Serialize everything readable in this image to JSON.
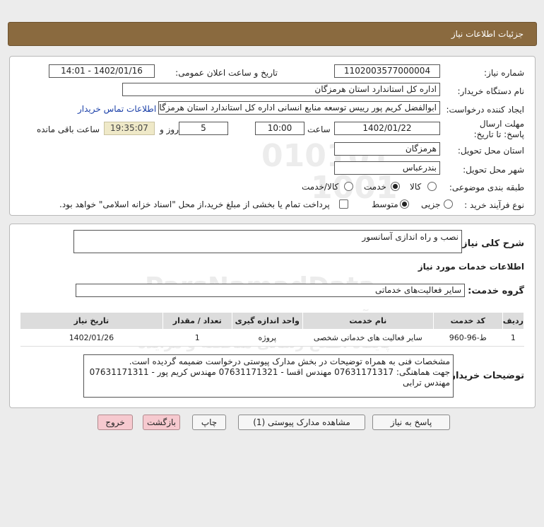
{
  "header": {
    "title": "جزئیات اطلاعات نیاز"
  },
  "form": {
    "need_number_label": "شماره نیاز:",
    "need_number": "1102003577000004",
    "announce_label": "تاریخ و ساعت اعلان عمومی:",
    "announce_value": "1402/01/16 - 14:01",
    "buyer_label": "نام دستگاه خریدار:",
    "buyer_value": "اداره کل استاندارد استان هرمزگان",
    "creator_label": "ایجاد کننده درخواست:",
    "creator_value": "ابوالفضل کریم پور رییس توسعه منابع انسانی اداره کل استاندارد استان هرمزگان",
    "contact_link": "اطلاعات تماس خریدار",
    "deadline_label": "مهلت ارسال پاسخ: تا تاریخ:",
    "deadline_date": "1402/01/22",
    "time_label": "ساعت",
    "deadline_time": "10:00",
    "days_value": "5",
    "days_label": "روز و",
    "remaining_time": "19:35:07",
    "remaining_label": "ساعت باقی مانده",
    "province_label": "استان محل تحویل:",
    "province_value": "هرمزگان",
    "city_label": "شهر محل تحویل:",
    "city_value": "بندرعباس",
    "category_label": "طبقه بندی موضوعی:",
    "category_options": [
      "کالا",
      "خدمت",
      "کالا/خدمت"
    ],
    "category_selected": "خدمت",
    "process_label": "نوع فرآیند خرید :",
    "process_options": [
      "جزیی",
      "متوسط"
    ],
    "process_selected": "متوسط",
    "payment_note": "پرداخت تمام یا بخشی از مبلغ خرید،از محل \"اسناد خزانه اسلامی\" خواهد بود."
  },
  "details": {
    "general_desc_label": "شرح کلی نیاز:",
    "general_desc_value": "نصب و راه اندازی آسانسور",
    "services_heading": "اطلاعات خدمات مورد نیاز",
    "service_group_label": "گروه خدمت:",
    "service_group_value": "سایر فعالیت‌های خدماتی",
    "table": {
      "headers": [
        "ردیف",
        "کد خدمت",
        "نام خدمت",
        "واحد اندازه گیری",
        "تعداد / مقدار",
        "تاریخ نیاز"
      ],
      "rows": [
        [
          "1",
          "ط-96-960",
          "سایر فعالیت های خدماتی شخصی",
          "پروژه",
          "1",
          "1402/01/26"
        ]
      ]
    },
    "buyer_notes_label": "توضیحات خریدار:",
    "buyer_notes_line1": "مشخصات فنی به همراه توضیحات در بخش مدارک پیوستی درخواست ضمیمه گردیده است.",
    "buyer_notes_line2": "جهت هماهنگی: 07631171317 مهندس اقسا - 07631171321 مهندس کریم پور - 07631171311",
    "buyer_notes_line3": "مهندس ترابی"
  },
  "buttons": {
    "reply": "پاسخ به نیاز",
    "attachments": "مشاهده مدارک پیوستی (1)",
    "print": "چاپ",
    "back": "بازگشت",
    "exit": "خروج"
  },
  "watermark": {
    "digits1": "010101",
    "digits2": "1001",
    "brand": "ParsNamadData",
    "fa_line1": "مرکز فراهم آوری اطلاعات پارس نماد داده",
    "fa_line2": "پایگاه اطلاع رسانی مناقصه و مزایده"
  }
}
